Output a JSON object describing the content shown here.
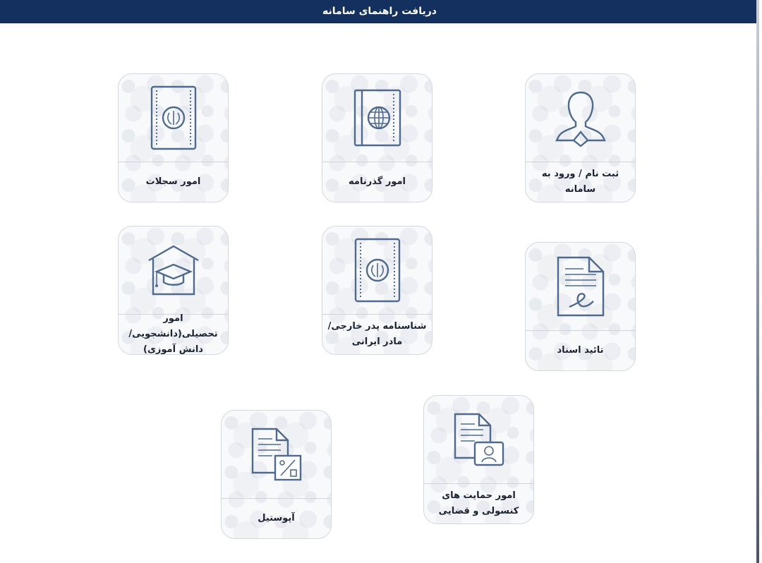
{
  "window": {
    "title": "دریافت راهنمای سامانه"
  },
  "cards": [
    {
      "label": "ثبت نام / ورود به سامانه",
      "icon": "user-icon"
    },
    {
      "label": "امور گذرنامه",
      "icon": "passport-globe-icon"
    },
    {
      "label": "امور سجلات",
      "icon": "emblem-book-icon"
    },
    {
      "label": "تائید اسناد",
      "icon": "signed-document-icon"
    },
    {
      "label": "شناسنامه پدر خارجی/مادر ایرانی",
      "icon": "birth-certificate-icon"
    },
    {
      "label": "امور تحصیلی(دانشجویی/ دانش آموزی)",
      "icon": "graduation-school-icon"
    },
    {
      "label": "امور حمایت های کنسولی و قضایی",
      "icon": "consular-support-icon"
    },
    {
      "label": "آپوستیل",
      "icon": "apostille-document-icon"
    }
  ]
}
